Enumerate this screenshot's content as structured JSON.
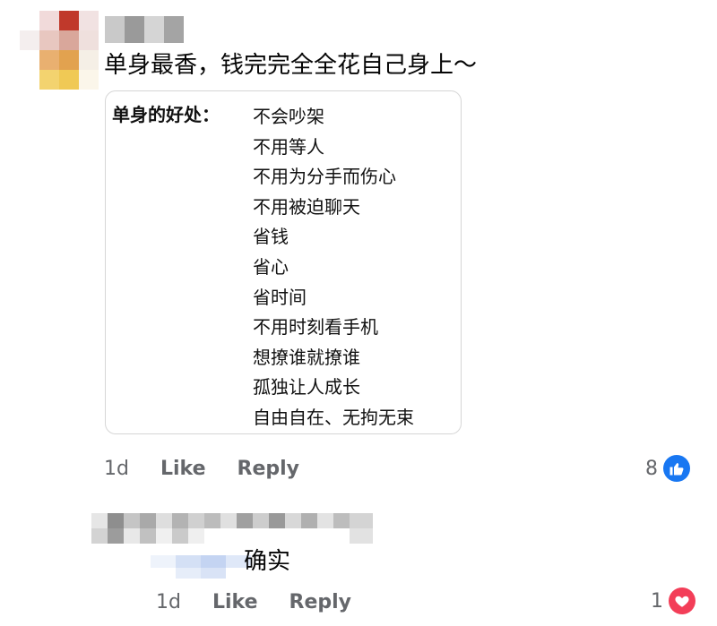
{
  "comments": [
    {
      "text": "单身最香，钱完完全全花自己身上～",
      "attachment": {
        "heading": "单身的好处：",
        "items": [
          "不会吵架",
          "不用等人",
          "不用为分手而伤心",
          "不用被迫聊天",
          "省钱",
          "省心",
          "省时间",
          "不用时刻看手机",
          "想撩谁就撩谁",
          "孤独让人成长",
          "自由自在、无拘无束"
        ]
      },
      "time": "1d",
      "like_label": "Like",
      "reply_label": "Reply",
      "reaction_count": "8",
      "reaction_icon": "thumbs-up-icon"
    },
    {
      "text": "确实",
      "time": "1d",
      "like_label": "Like",
      "reply_label": "Reply",
      "reaction_count": "1",
      "reaction_icon": "heart-icon"
    }
  ],
  "colors": {
    "like_blue": "#1877f2",
    "love_red": "#f33e58",
    "action_gray": "#65676b"
  }
}
